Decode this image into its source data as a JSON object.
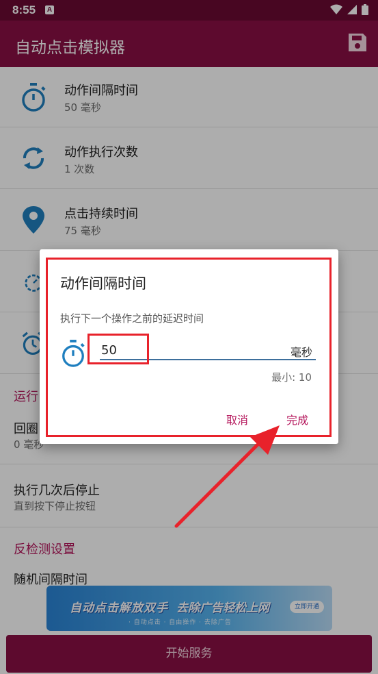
{
  "status_bar": {
    "time": "8:55",
    "notification_letter": "A"
  },
  "app_bar": {
    "title": "自动点击模拟器",
    "save_icon": "save-icon"
  },
  "settings": [
    {
      "title": "动作间隔时间",
      "value": "50 毫秒",
      "icon": "stopwatch-icon"
    },
    {
      "title": "动作执行次数",
      "value": "1 次数",
      "icon": "repeat-icon"
    },
    {
      "title": "点击持续时间",
      "value": "75 毫秒",
      "icon": "location-pin-icon"
    }
  ],
  "run_section": {
    "header": "运行",
    "loop_row": {
      "title": "回圈",
      "value": "0 毫秒"
    },
    "stop_row": {
      "title": "执行几次后停止",
      "value": "直到按下停止按钮"
    }
  },
  "anti_detect": {
    "header": "反检测设置",
    "random_row": {
      "title": "随机间隔时间"
    }
  },
  "banner": {
    "text_left": "自动点击解放双手",
    "text_right": "去除广告轻松上网",
    "cta": "立即开通",
    "sub": "· 自动点击 · 自由操作 · 去除广告"
  },
  "start_button": "开始服务",
  "dialog": {
    "title": "动作间隔时间",
    "description": "执行下一个操作之前的延迟时间",
    "input_value": "50",
    "unit": "毫秒",
    "min_label": "最小: 10",
    "cancel": "取消",
    "done": "完成"
  },
  "colors": {
    "status_bar": "#6a0a33",
    "app_bar": "#8a0f44",
    "accent": "#b4145a",
    "icon_blue": "#1f7fbf",
    "annotation_red": "#e8222b"
  }
}
